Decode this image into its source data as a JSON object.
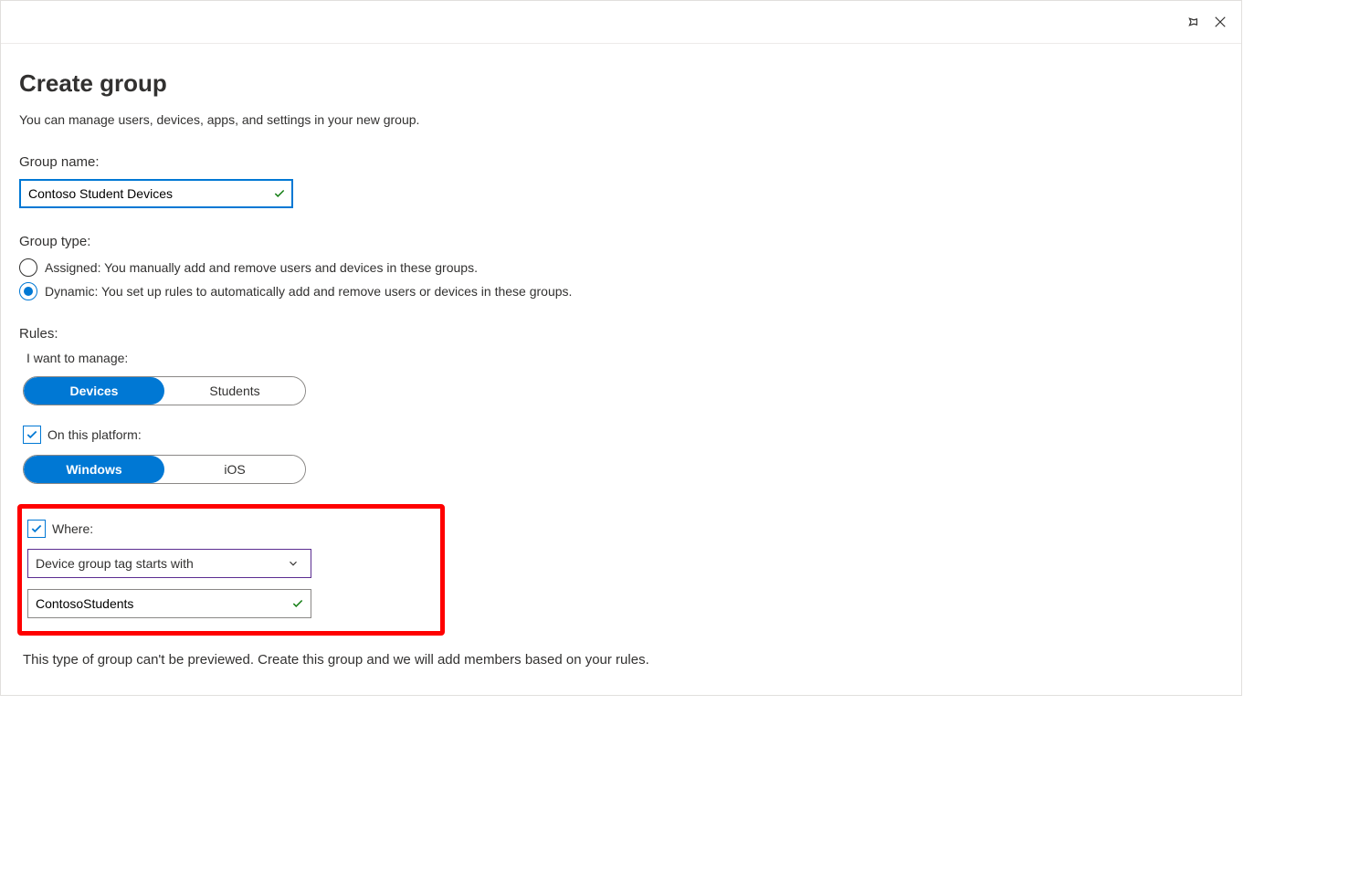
{
  "header": {
    "pin_icon": "pin-icon",
    "close_icon": "close-icon"
  },
  "page": {
    "title": "Create group",
    "description": "You can manage users, devices, apps, and settings in your new group."
  },
  "group_name": {
    "label": "Group name:",
    "value": "Contoso Student Devices"
  },
  "group_type": {
    "label": "Group type:",
    "options": [
      {
        "key": "assigned",
        "label": "Assigned: You manually add and remove users and devices in these groups.",
        "selected": false
      },
      {
        "key": "dynamic",
        "label": "Dynamic: You set up rules to automatically add and remove users or devices in these groups.",
        "selected": true
      }
    ]
  },
  "rules": {
    "label": "Rules:",
    "manage_label": "I want to manage:",
    "manage_toggle": {
      "left": "Devices",
      "right": "Students",
      "active": "left"
    },
    "platform_check_label": "On this platform:",
    "platform_checked": true,
    "platform_toggle": {
      "left": "Windows",
      "right": "iOS",
      "active": "left"
    },
    "where_check_label": "Where:",
    "where_checked": true,
    "where_dropdown_value": "Device group tag starts with",
    "where_input_value": "ContosoStudents"
  },
  "preview_note": "This type of group can't be previewed. Create this group and we will add members based on your rules."
}
